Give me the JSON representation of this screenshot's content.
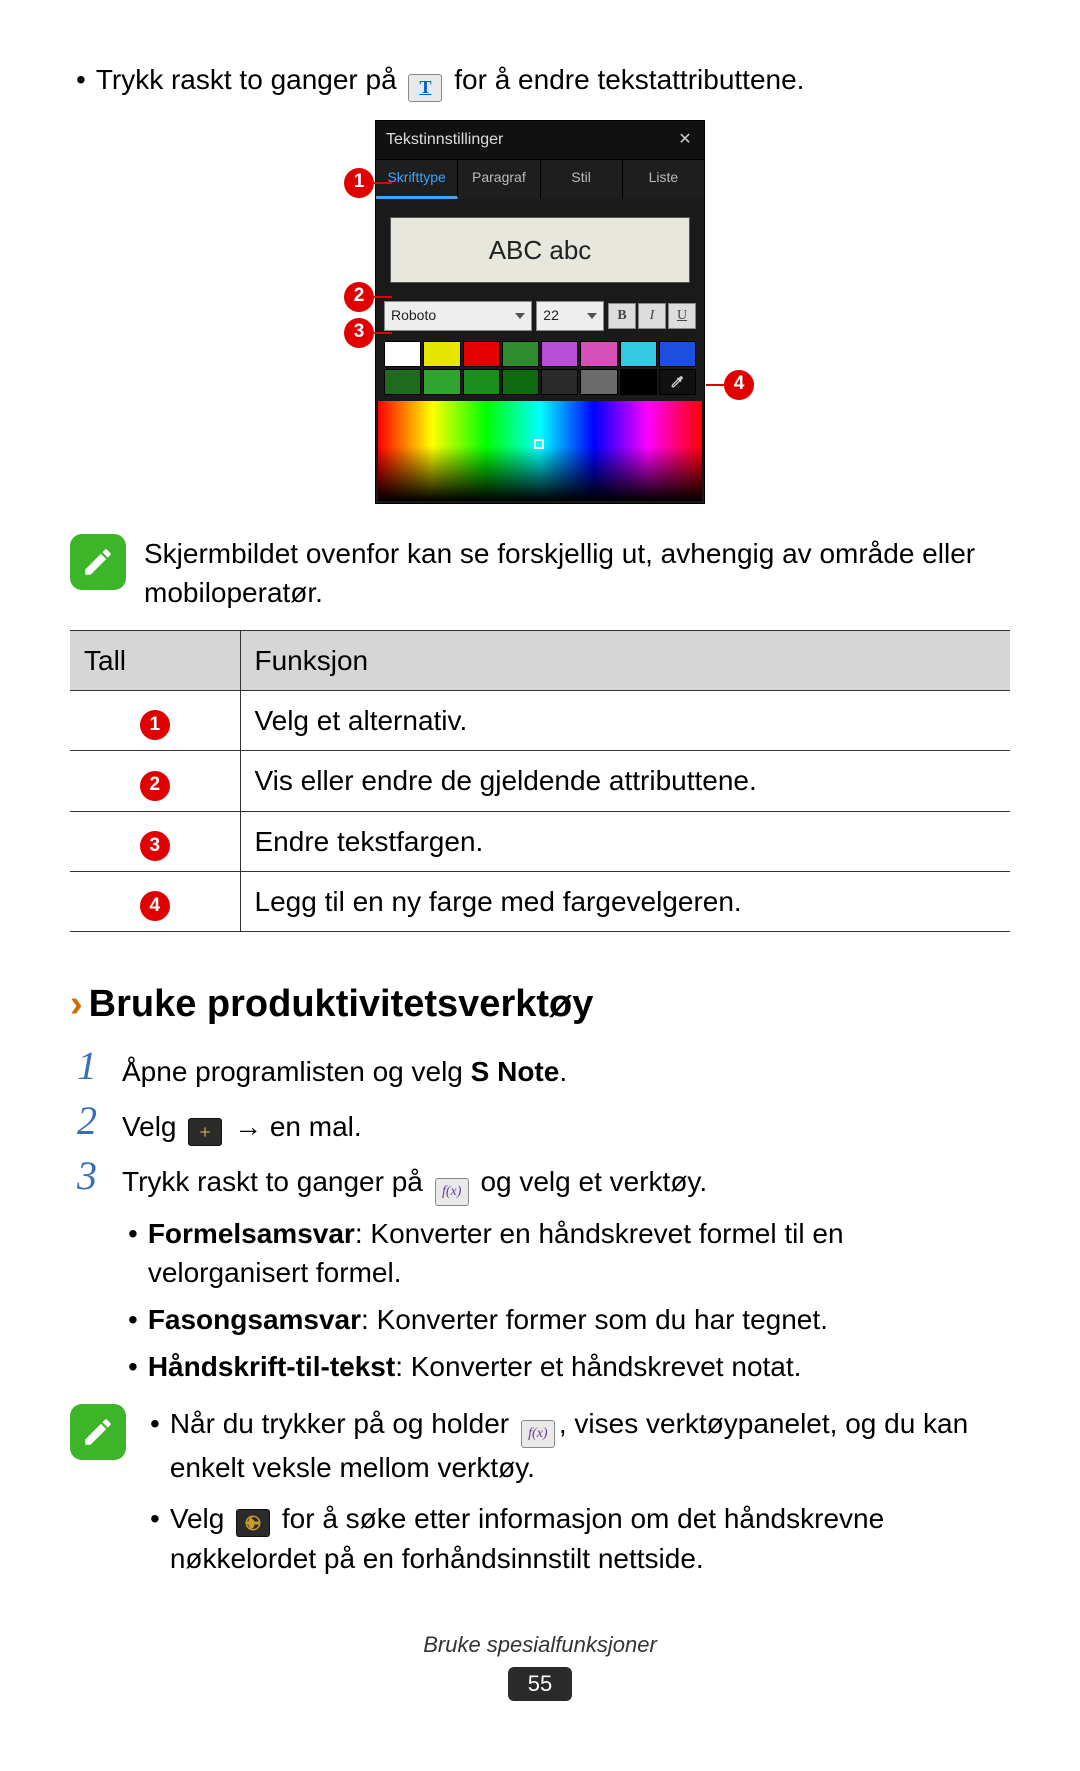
{
  "intro_bullet_a": "Trykk raskt to ganger på ",
  "intro_bullet_b": " for å endre tekstattributtene.",
  "intro_icon_letter": "T",
  "mock": {
    "title": "Tekstinnstillinger",
    "tabs": [
      "Skrifttype",
      "Paragraf",
      "Stil",
      "Liste"
    ],
    "preview": "ABC abc",
    "font": "Roboto",
    "size": "22",
    "style_b": "B",
    "style_i": "I",
    "style_u": "U",
    "swatch_row1": [
      "#ffffff",
      "#e6e600",
      "#e60000",
      "#2e8b2e",
      "#b84fd6",
      "#d64fb8",
      "#34c9e0",
      "#1b4fe0"
    ],
    "swatch_row2": [
      "#1e6b1e",
      "#2fa52f",
      "#1b8f1b",
      "#0f6b0f",
      "#2a2a2a",
      "#6b6b6b",
      "#000000"
    ]
  },
  "note1": "Skjermbildet ovenfor kan se forskjellig ut, avhengig av område eller mobiloperatør.",
  "table": {
    "head_num": "Tall",
    "head_fn": "Funksjon",
    "rows": [
      {
        "n": "1",
        "fn": "Velg et alternativ."
      },
      {
        "n": "2",
        "fn": "Vis eller endre de gjeldende attributtene."
      },
      {
        "n": "3",
        "fn": "Endre tekstfargen."
      },
      {
        "n": "4",
        "fn": "Legg til en ny farge med fargevelgeren."
      }
    ]
  },
  "section_title": "Bruke produktivitetsverktøy",
  "steps": {
    "s1_a": "Åpne programlisten og velg ",
    "s1_bold": "S Note",
    "s1_b": ".",
    "s2_a": "Velg ",
    "s2_b": " → en mal.",
    "s3_a": "Trykk raskt to ganger på ",
    "s3_b": " og velg et verktøy.",
    "s3_sub": [
      {
        "bold": "Formelsamsvar",
        "txt": ": Konverter en håndskrevet formel til en velorganisert formel."
      },
      {
        "bold": "Fasongsamsvar",
        "txt": ": Konverter former som du har tegnet."
      },
      {
        "bold": "Håndskrift-til-tekst",
        "txt": ": Konverter et håndskrevet notat."
      }
    ]
  },
  "tips": {
    "t1_a": "Når du trykker på og holder ",
    "t1_b": ", vises verktøypanelet, og du kan enkelt veksle mellom verktøy.",
    "t2_a": "Velg ",
    "t2_b": " for å søke etter informasjon om det håndskrevne nøkkelordet på en forhåndsinnstilt nettside."
  },
  "footer_title": "Bruke spesialfunksjoner",
  "page_number": "55",
  "step_numbers": {
    "one": "1",
    "two": "2",
    "three": "3"
  },
  "callout_numbers": {
    "one": "1",
    "two": "2",
    "three": "3",
    "four": "4"
  }
}
